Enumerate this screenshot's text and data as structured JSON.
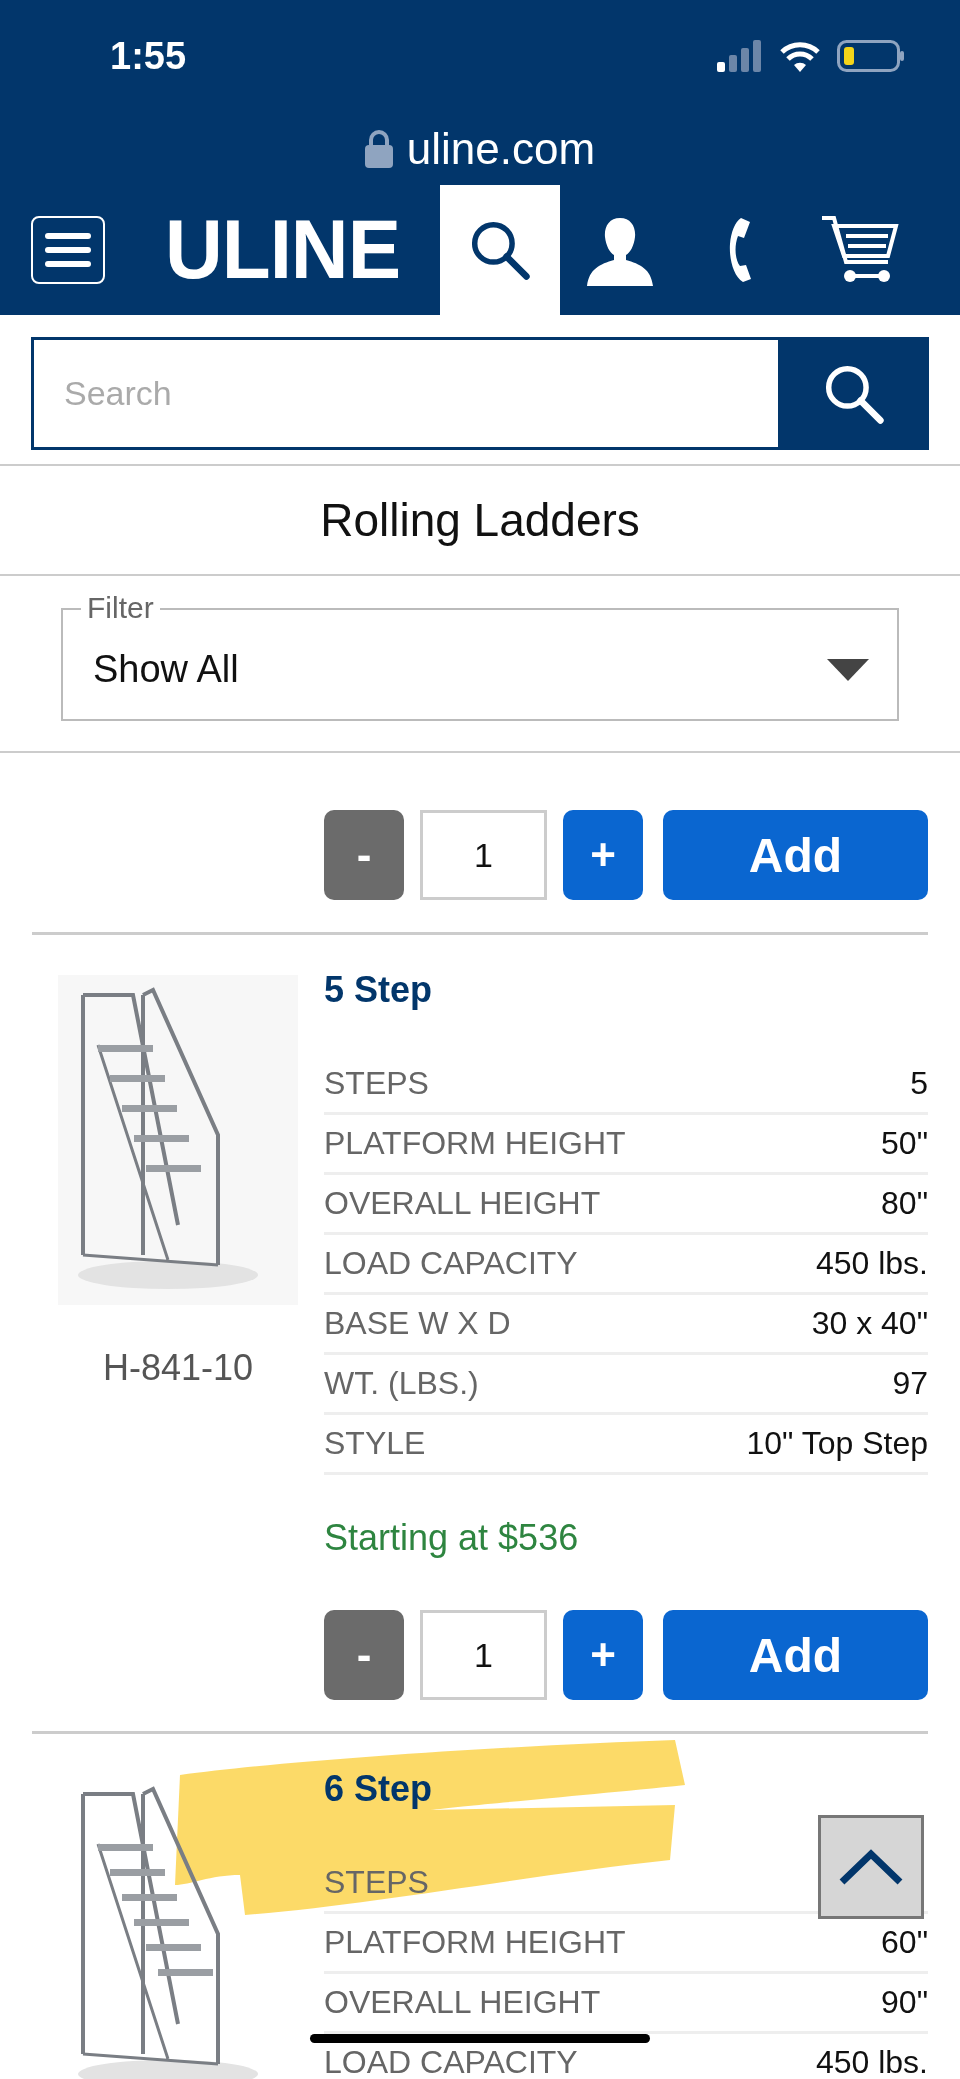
{
  "status_bar": {
    "time": "1:55"
  },
  "address_bar": {
    "url": "uline.com"
  },
  "nav": {
    "logo": "ULINE",
    "items": [
      {
        "kind": "menu",
        "selected": false
      },
      {
        "kind": "search",
        "selected": true
      },
      {
        "kind": "account",
        "selected": false
      },
      {
        "kind": "phone",
        "selected": false
      },
      {
        "kind": "cart",
        "selected": false
      }
    ]
  },
  "search": {
    "placeholder": "Search"
  },
  "page_title": "Rolling Ladders",
  "filter": {
    "label": "Filter",
    "value": "Show All"
  },
  "products": [
    {
      "kind": "partial",
      "quantity": "1",
      "minus": "-",
      "plus": "+",
      "add": "Add"
    },
    {
      "kind": "full",
      "title": "5 Step",
      "sku": "H-841-10",
      "specs": [
        {
          "label": "STEPS",
          "value": "5"
        },
        {
          "label": "PLATFORM HEIGHT",
          "value": "50\""
        },
        {
          "label": "OVERALL HEIGHT",
          "value": "80\""
        },
        {
          "label": "LOAD CAPACITY",
          "value": "450 lbs."
        },
        {
          "label": "BASE W X D",
          "value": "30 x 40\""
        },
        {
          "label": "WT. (LBS.)",
          "value": "97"
        },
        {
          "label": "STYLE",
          "value": "10\" Top Step"
        }
      ],
      "price": "Starting at $536",
      "quantity": "1",
      "minus": "-",
      "plus": "+",
      "add": "Add"
    },
    {
      "kind": "cut",
      "title": "6 Step",
      "highlighted": true,
      "specs": [
        {
          "label": "STEPS"
        },
        {
          "label": "PLATFORM HEIGHT",
          "value": "60\""
        },
        {
          "label": "OVERALL HEIGHT",
          "value": "90\""
        },
        {
          "label": "LOAD CAPACITY",
          "value": "450 lbs."
        }
      ]
    }
  ]
}
